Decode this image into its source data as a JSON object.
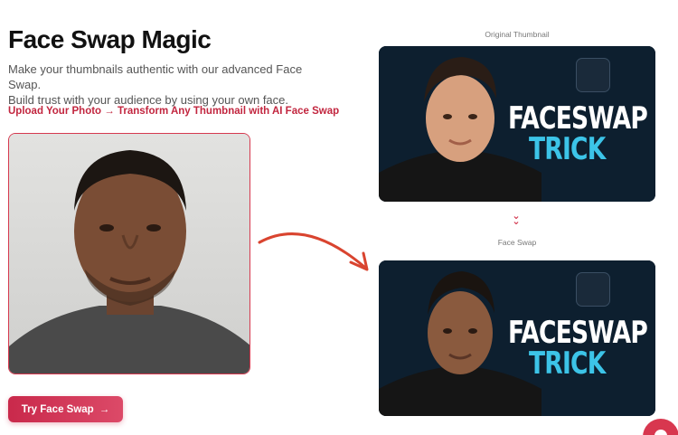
{
  "hero": {
    "title": "Face Swap Magic",
    "description_line1": "Make your thumbnails authentic with our advanced Face Swap.",
    "description_line2": "Build trust with your audience by using your own face.",
    "tagline": "Upload Your Photo → Transform Any Thumbnail with AI Face Swap"
  },
  "cta": {
    "label": "Try Face Swap",
    "arrow": "→"
  },
  "preview": {
    "original_caption": "Original Thumbnail",
    "swap_caption": "Face Swap",
    "thumb_word1": "FACESWAP",
    "thumb_word2": "TRICK"
  },
  "colors": {
    "accent": "#c9294b",
    "thumb_accent": "#3cc4e8"
  },
  "icons": [
    "curved-arrow-icon",
    "chevron-double-down-icon",
    "faces-logo-icon",
    "help-bubble-icon"
  ]
}
